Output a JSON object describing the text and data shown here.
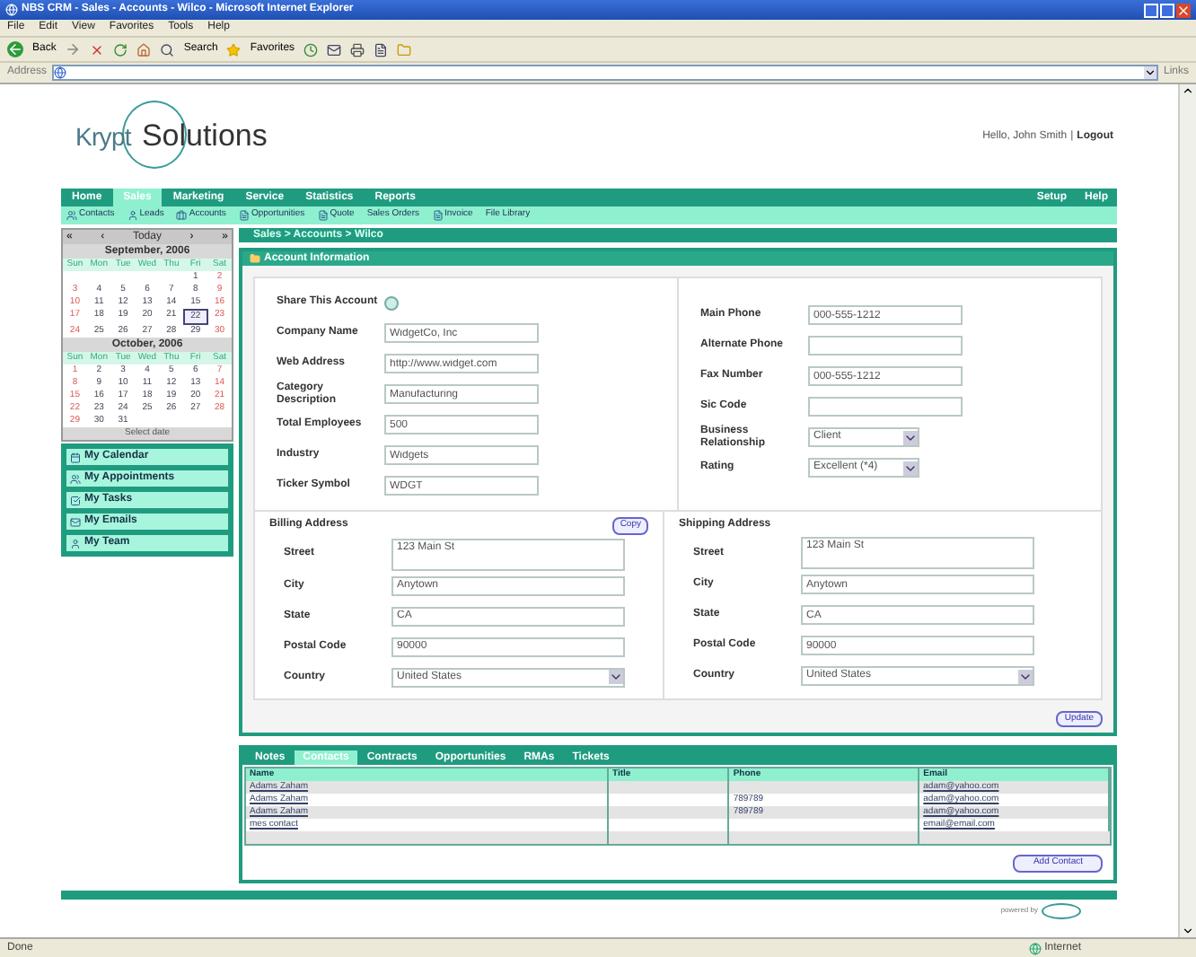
{
  "browser": {
    "title": "NBS CRM - Sales - Accounts - Wilco - Microsoft Internet Explorer",
    "menu": [
      "File",
      "Edit",
      "View",
      "Favorites",
      "Tools",
      "Help"
    ],
    "back": "Back",
    "search": "Search",
    "favorites": "Favorites",
    "address_label": "Address",
    "links_label": "Links"
  },
  "header": {
    "logo_first": "Krypt",
    "logo_second": "Solutions",
    "greeting": "Hello, John Smith",
    "separator": "|",
    "logout": "Logout"
  },
  "nav": [
    {
      "label": "Home",
      "selected": false
    },
    {
      "label": "Sales",
      "selected": true
    },
    {
      "label": "Marketing",
      "selected": false
    },
    {
      "label": "Service",
      "selected": false
    },
    {
      "label": "Statistics",
      "selected": false
    },
    {
      "label": "Reports",
      "selected": false
    }
  ],
  "nav_right": [
    "Setup",
    "Help"
  ],
  "subnav": [
    "Contacts",
    "Leads",
    "Accounts",
    "Opportunities",
    "Quote",
    "Sales Orders",
    "Invoice",
    "File Library"
  ],
  "breadcrumb": "Sales > Accounts > Wilco",
  "calendar": {
    "today": "Today",
    "prev": "«",
    "prev_month": "‹",
    "next_month": "›",
    "next": "»",
    "footer": "Select date",
    "months": [
      {
        "title": "September, 2006",
        "weekdays": [
          "Sun",
          "Mon",
          "Tue",
          "Wed",
          "Thu",
          "Fri",
          "Sat"
        ],
        "weeks": [
          [
            {
              "day": "1",
              "selected": false
            },
            {
              "day": "2",
              "selected": false
            }
          ],
          [
            {
              "day": "3",
              "selected": false
            },
            {
              "day": "4",
              "selected": false
            },
            {
              "day": "5",
              "selected": false
            },
            {
              "day": "6",
              "selected": false
            },
            {
              "day": "7",
              "selected": false
            },
            {
              "day": "8",
              "selected": false
            },
            {
              "day": "9",
              "selected": false
            }
          ],
          [
            {
              "day": "10",
              "selected": false
            },
            {
              "day": "11",
              "selected": false
            },
            {
              "day": "12",
              "selected": false
            },
            {
              "day": "13",
              "selected": false
            },
            {
              "day": "14",
              "selected": false
            },
            {
              "day": "15",
              "selected": false
            },
            {
              "day": "16",
              "selected": false
            }
          ],
          [
            {
              "day": "17",
              "selected": false
            },
            {
              "day": "18",
              "selected": false
            },
            {
              "day": "19",
              "selected": false
            },
            {
              "day": "20",
              "selected": false
            },
            {
              "day": "21",
              "selected": false
            },
            {
              "day": "22",
              "selected": true
            },
            {
              "day": "23",
              "selected": false
            }
          ],
          [
            {
              "day": "24",
              "selected": false
            },
            {
              "day": "25",
              "selected": false
            },
            {
              "day": "26",
              "selected": false
            },
            {
              "day": "27",
              "selected": false
            },
            {
              "day": "28",
              "selected": false
            },
            {
              "day": "29",
              "selected": false
            },
            {
              "day": "30",
              "selected": false
            }
          ]
        ]
      },
      {
        "title": "October, 2006",
        "weekdays": [
          "Sun",
          "Mon",
          "Tue",
          "Wed",
          "Thu",
          "Fri",
          "Sat"
        ],
        "weeks": [
          [
            {
              "day": "1",
              "selected": false
            },
            {
              "day": "2",
              "selected": false
            },
            {
              "day": "3",
              "selected": false
            },
            {
              "day": "4",
              "selected": false
            },
            {
              "day": "5",
              "selected": false
            },
            {
              "day": "6",
              "selected": false
            },
            {
              "day": "7",
              "selected": false
            }
          ],
          [
            {
              "day": "8",
              "selected": false
            },
            {
              "day": "9",
              "selected": false
            },
            {
              "day": "10",
              "selected": false
            },
            {
              "day": "11",
              "selected": false
            },
            {
              "day": "12",
              "selected": false
            },
            {
              "day": "13",
              "selected": false
            },
            {
              "day": "14",
              "selected": false
            }
          ],
          [
            {
              "day": "15",
              "selected": false
            },
            {
              "day": "16",
              "selected": false
            },
            {
              "day": "17",
              "selected": false
            },
            {
              "day": "18",
              "selected": false
            },
            {
              "day": "19",
              "selected": false
            },
            {
              "day": "20",
              "selected": false
            },
            {
              "day": "21",
              "selected": false
            }
          ],
          [
            {
              "day": "22",
              "selected": false
            },
            {
              "day": "23",
              "selected": false
            },
            {
              "day": "24",
              "selected": false
            },
            {
              "day": "25",
              "selected": false
            },
            {
              "day": "26",
              "selected": false
            },
            {
              "day": "27",
              "selected": false
            },
            {
              "day": "28",
              "selected": false
            }
          ],
          [
            {
              "day": "29",
              "selected": false
            },
            {
              "day": "30",
              "selected": false
            },
            {
              "day": "31",
              "selected": false
            }
          ]
        ]
      }
    ]
  },
  "sidebar_links": [
    "My Calendar",
    "My Appointments",
    "My Tasks",
    "My Emails",
    "My Team"
  ],
  "account": {
    "title": "Account Information",
    "left_fields": [
      {
        "label": "Share This Account",
        "kind": "checkbox",
        "checked": false
      },
      {
        "label": "Company Name",
        "kind": "text",
        "value": "WidgetCo, Inc"
      },
      {
        "label": "Web Address",
        "kind": "text",
        "value": "http://www.widget.com"
      },
      {
        "label": "Category Description",
        "kind": "text",
        "value": "Manufacturing"
      },
      {
        "label": "Total Employees",
        "kind": "text",
        "value": "500"
      },
      {
        "label": "Industry",
        "kind": "text",
        "value": "Widgets"
      },
      {
        "label": "Ticker Symbol",
        "kind": "text",
        "value": "WDGT"
      }
    ],
    "right_fields": [
      {
        "label": "Main Phone",
        "kind": "text",
        "value": "000-555-1212"
      },
      {
        "label": "Alternate Phone",
        "kind": "text"
      },
      {
        "label": "Fax Number",
        "kind": "text",
        "value": "000-555-1212"
      },
      {
        "label": "Sic Code",
        "kind": "text"
      },
      {
        "label": "Business Relationship",
        "kind": "select",
        "value": "Client"
      },
      {
        "label": "Rating",
        "kind": "select",
        "value": "Excellent (*4)"
      }
    ]
  },
  "billing": {
    "title": "Billing Address",
    "copy": "Copy",
    "fields": [
      {
        "label": "Street",
        "kind": "textarea",
        "value": "123 Main St"
      },
      {
        "label": "City",
        "kind": "text",
        "value": "Anytown"
      },
      {
        "label": "State",
        "kind": "text",
        "value": "CA"
      },
      {
        "label": "Postal Code",
        "kind": "text",
        "value": "90000"
      },
      {
        "label": "Country",
        "kind": "select",
        "value": "United States"
      }
    ]
  },
  "shipping": {
    "title": "Shipping Address",
    "fields": [
      {
        "label": "Street",
        "kind": "textarea",
        "value": "123 Main St"
      },
      {
        "label": "City",
        "kind": "text",
        "value": "Anytown"
      },
      {
        "label": "State",
        "kind": "text",
        "value": "CA"
      },
      {
        "label": "Postal Code",
        "kind": "text",
        "value": "90000"
      },
      {
        "label": "Country",
        "kind": "select",
        "value": "United States"
      }
    ]
  },
  "update": "Update",
  "tabs": [
    {
      "label": "Notes",
      "selected": false
    },
    {
      "label": "Contacts",
      "selected": true
    },
    {
      "label": "Contracts",
      "selected": false
    },
    {
      "label": "Opportunities",
      "selected": false
    },
    {
      "label": "RMAs",
      "selected": false
    },
    {
      "label": "Tickets",
      "selected": false
    }
  ],
  "contacts": {
    "columns": [
      "Name",
      "Title",
      "Phone",
      "Email"
    ],
    "rows": [
      [
        "Adams Zaham",
        "",
        "",
        "adam@yahoo.com"
      ],
      [
        "Adams Zaham",
        "",
        "789789",
        "adam@yahoo.com"
      ],
      [
        "Adams Zaham",
        "",
        "789789",
        "adam@yahoo.com"
      ],
      [
        "mes contact",
        "",
        "",
        "email@email.com"
      ]
    ]
  },
  "add_contact": "Add Contact",
  "footer": {
    "powered": "powered by"
  },
  "status": {
    "left": "Done",
    "right": "Internet"
  }
}
